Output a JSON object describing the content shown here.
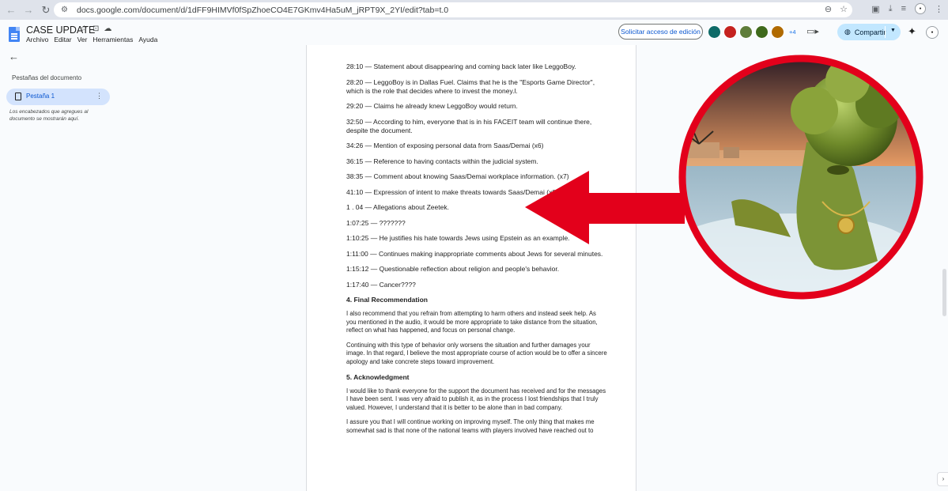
{
  "browser": {
    "url": "docs.google.com/document/d/1dFF9HIMVf0fSpZhoeCO4E7GKmv4Ha5uM_jRPT9X_2YI/edit?tab=t.0"
  },
  "doc": {
    "title": "CASE UPDATE",
    "menu": [
      "Archivo",
      "Editar",
      "Ver",
      "Herramientas",
      "Ayuda"
    ],
    "request_access_label": "Solicitar acceso de edición",
    "collaborators_extra": "+4",
    "share_label": "Compartir"
  },
  "sidebar": {
    "heading": "Pestañas del documento",
    "tab_label": "Pestaña 1",
    "note": "Los encabezados que agregues al documento se mostrarán aquí."
  },
  "content": {
    "timestamps": [
      "28:10 — Statement about disappearing and coming back later like LeggoBoy.",
      "28:20 — LeggoBoy is in Dallas Fuel. Claims that he is the \"Esports Game Director\", which is the role that decides where to invest the money.l.",
      "29:20 — Claims he already knew LeggoBoy would return.",
      "32:50 — According to him, everyone that is in his FACEIT team will continue there, despite the document.",
      "34:26 — Mention of exposing personal data from Saas/Demai (x6)",
      "36:15 — Reference to having contacts within the judicial system.",
      "38:35 — Comment about knowing Saas/Demai workplace information. (x7)",
      "41:10 — Expression of intent to make threats towards Saas/Demai (x8)",
      "1 . 04  — Allegations about Zeetek.",
      "1:07:25 — ???????",
      "1:10:25 — He justifies his hate towards Jews using Epstein as an example.",
      "1:11:00 — Continues making inappropriate comments about Jews for several minutes.",
      "1:15:12 — Questionable reflection about religion and people's behavior.",
      "1:17:40 — Cancer????"
    ],
    "section4_title": "4. Final Recommendation",
    "section4_p1": "I also recommend that you refrain from attempting to harm others and instead seek help. As you mentioned in the audio, it would be more appropriate to take distance from the situation, reflect on what has happened, and focus on personal change.",
    "section4_p2": "Continuing with this type of behavior only worsens the situation and further damages your image. In that regard, I believe the most appropriate course of action would be to offer a sincere apology and take concrete steps toward improvement.",
    "section5_title": "5. Acknowledgment",
    "section5_p1": "I would like to thank everyone for the support the document has received and for the messages I have been sent. I was very afraid to publish it, as in the process I lost friendships that I truly valued. However, I understand that it is better to be alone than in bad company.",
    "section5_p2": "I assure you that I will continue working on improving myself. The only thing that makes me somewhat sad is that none of the national teams with players involved have reached out to"
  },
  "colors": {
    "accent": "#0b57d0",
    "arrow": "#e3001b",
    "share_bg": "#c2e7ff",
    "tab_bg": "#d3e3fd"
  },
  "icons": [
    "back-icon",
    "forward-icon",
    "reload-icon",
    "star-icon",
    "cloud-icon",
    "globe-icon",
    "gemini-icon",
    "document-icon",
    "kebab-icon"
  ]
}
